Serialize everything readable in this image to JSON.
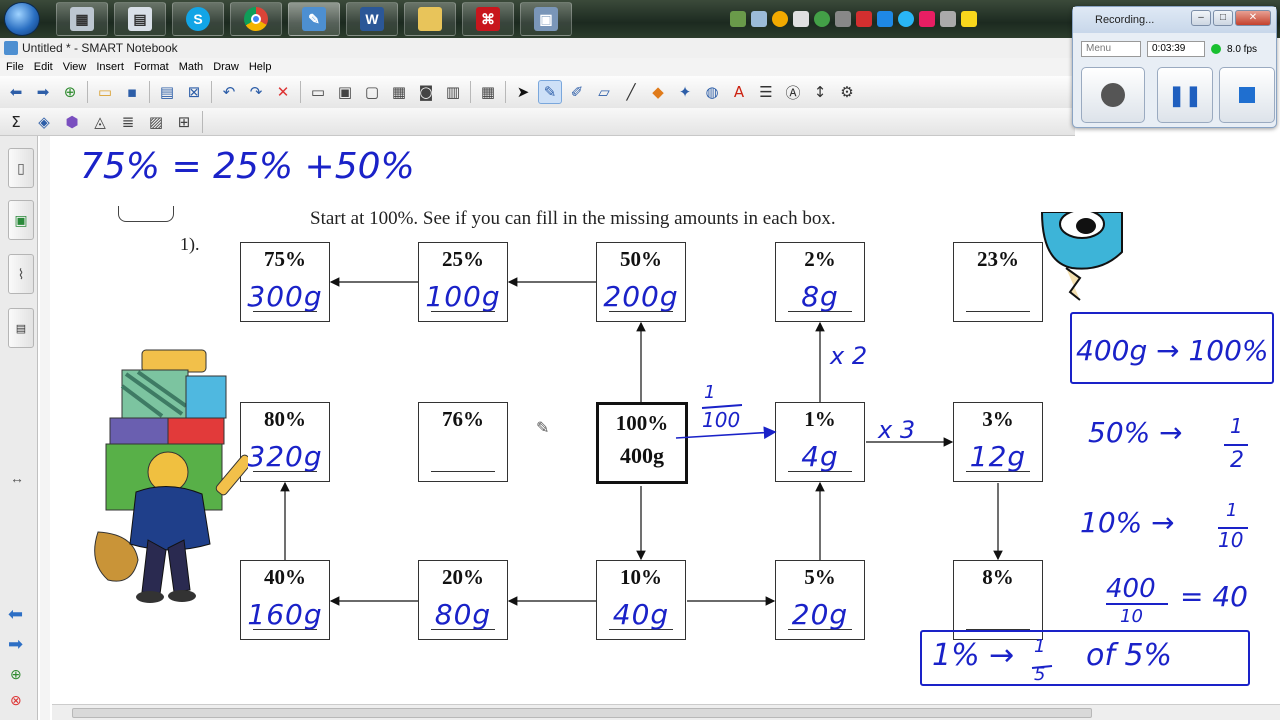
{
  "taskbar": {
    "apps": [
      "calculator",
      "calculator-2",
      "skype",
      "chrome",
      "notebook",
      "word",
      "folder",
      "acrobat",
      "network"
    ],
    "word_letter": "W"
  },
  "window": {
    "title": "Untitled * - SMART Notebook"
  },
  "menu": [
    "File",
    "Edit",
    "View",
    "Insert",
    "Format",
    "Math",
    "Draw",
    "Help"
  ],
  "recorder": {
    "title": "Recording...",
    "menu_label": "Menu",
    "elapsed": "0:03:39",
    "fps": "8.0 fps"
  },
  "worksheet": {
    "instruction": "Start at 100%. See if you can fill in the missing amounts in each box.",
    "question_number": "1).",
    "boxes": [
      {
        "id": "b75",
        "pct": "75%",
        "answer": "300g"
      },
      {
        "id": "b25",
        "pct": "25%",
        "answer": "100g"
      },
      {
        "id": "b50",
        "pct": "50%",
        "answer": "200g"
      },
      {
        "id": "b2",
        "pct": "2%",
        "answer": "8g"
      },
      {
        "id": "b23",
        "pct": "23%",
        "answer": ""
      },
      {
        "id": "b80",
        "pct": "80%",
        "answer": "320g"
      },
      {
        "id": "b76",
        "pct": "76%",
        "answer": ""
      },
      {
        "id": "b1",
        "pct": "1%",
        "answer": "4g"
      },
      {
        "id": "b3",
        "pct": "3%",
        "answer": "12g"
      },
      {
        "id": "b40",
        "pct": "40%",
        "answer": "160g"
      },
      {
        "id": "b20",
        "pct": "20%",
        "answer": "80g"
      },
      {
        "id": "b10",
        "pct": "10%",
        "answer": "40g"
      },
      {
        "id": "b5",
        "pct": "5%",
        "answer": "20g"
      },
      {
        "id": "b8",
        "pct": "8%",
        "answer": ""
      }
    ],
    "center": {
      "pct": "100%",
      "val": "400g"
    }
  },
  "annotations": {
    "top_equation": "75% = 25% +50%",
    "fraction_num": "1",
    "fraction_den": "100",
    "times2": "x 2",
    "times3": "x 3",
    "rule1": "400g → 100%",
    "rule2_left": "50% →",
    "rule2_num": "1",
    "rule2_den": "2",
    "rule3_left": "10% →",
    "rule3_num": "1",
    "rule3_den": "10",
    "rule4_num": "400",
    "rule4_den": "10",
    "rule4_right": "= 40",
    "rule5_left": "1% →",
    "rule5_num": "1",
    "rule5_den": "5",
    "rule5_right": "of 5%"
  }
}
